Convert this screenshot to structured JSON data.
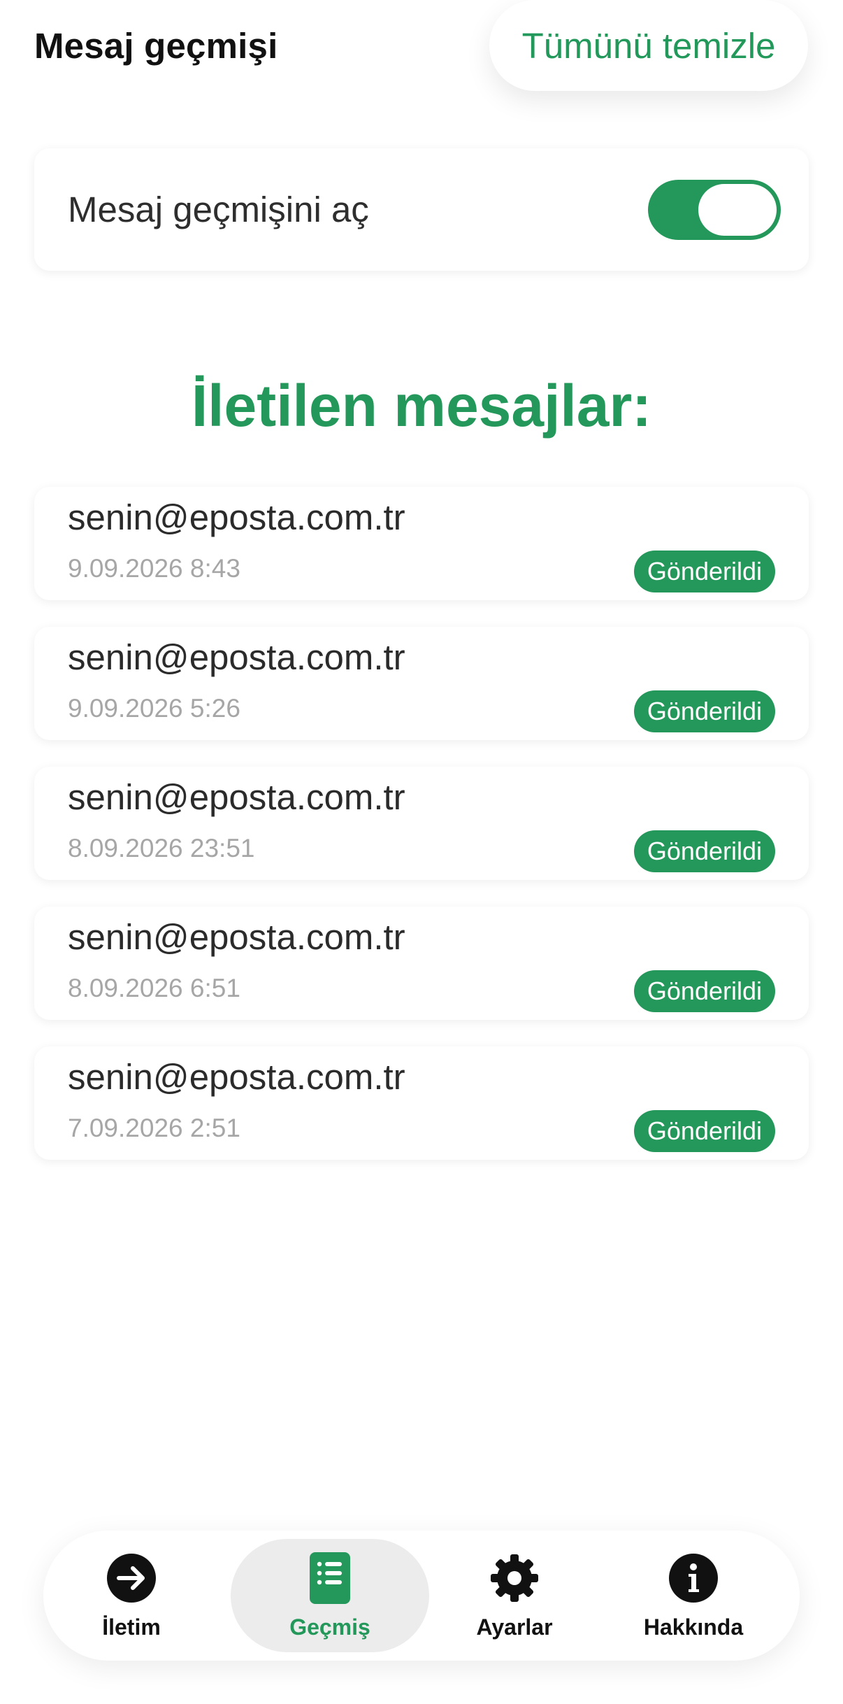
{
  "header": {
    "title": "Mesaj geçmişi",
    "clear_all_label": "Tümünü temizle"
  },
  "history_toggle": {
    "label": "Mesaj geçmişini aç",
    "enabled": true
  },
  "section": {
    "heading": "İletilen mesajlar:"
  },
  "messages": [
    {
      "recipient": "senin@eposta.com.tr",
      "time": "9.09.2026 8:43",
      "status": "Gönderildi"
    },
    {
      "recipient": "senin@eposta.com.tr",
      "time": "9.09.2026 5:26",
      "status": "Gönderildi"
    },
    {
      "recipient": "senin@eposta.com.tr",
      "time": "8.09.2026 23:51",
      "status": "Gönderildi"
    },
    {
      "recipient": "senin@eposta.com.tr",
      "time": "8.09.2026 6:51",
      "status": "Gönderildi"
    },
    {
      "recipient": "senin@eposta.com.tr",
      "time": "7.09.2026 2:51",
      "status": "Gönderildi"
    }
  ],
  "bottom_nav": {
    "items": [
      {
        "label": "İletim",
        "icon": "arrow-right-circle-icon"
      },
      {
        "label": "Geçmiş",
        "icon": "list-document-icon",
        "active": true
      },
      {
        "label": "Ayarlar",
        "icon": "gear-icon"
      },
      {
        "label": "Hakkında",
        "icon": "info-circle-icon"
      }
    ]
  },
  "colors": {
    "accent": "#24985a",
    "text_primary": "#111111",
    "text_muted": "#a6a6a6",
    "active_tab_bg": "#ececec"
  }
}
